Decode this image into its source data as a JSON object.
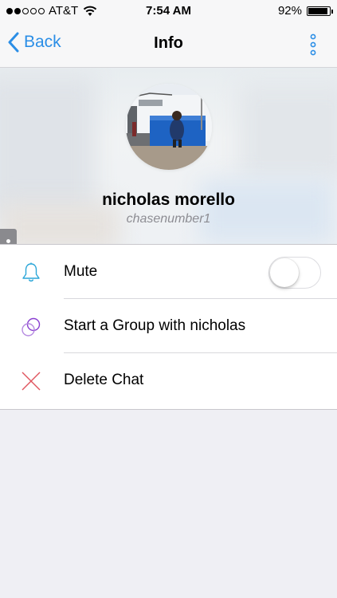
{
  "status_bar": {
    "carrier": "AT&T",
    "time": "7:54 AM",
    "battery_percent": "92%",
    "battery_level": 0.92,
    "signal_bars_filled": 2,
    "signal_bars_total": 5
  },
  "nav": {
    "back_label": "Back",
    "title": "Info",
    "accent_color": "#2b8ee6"
  },
  "profile": {
    "name": "nicholas morello",
    "username": "chasenumber1"
  },
  "rows": [
    {
      "label": "Mute",
      "icon": "bell-icon",
      "toggle_on": false
    },
    {
      "label": "Start a Group with nicholas",
      "icon": "group-circles-icon"
    },
    {
      "label": "Delete Chat",
      "icon": "x-icon"
    }
  ]
}
